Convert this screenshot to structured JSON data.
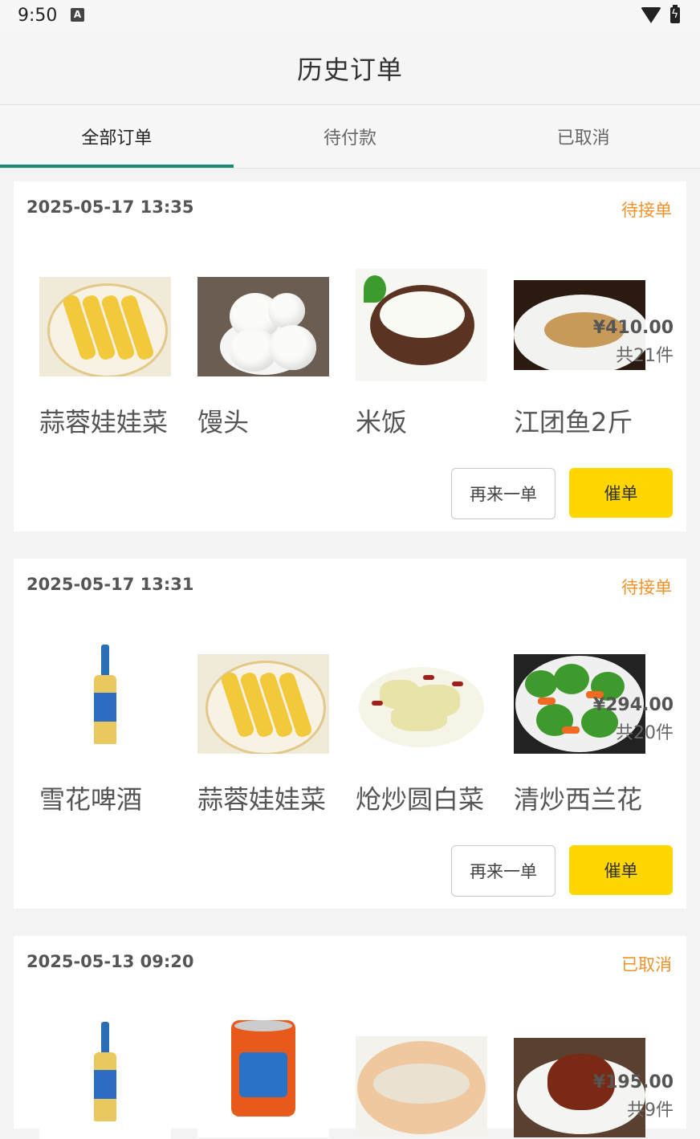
{
  "status_bar": {
    "time": "9:50",
    "notif_letter": "A"
  },
  "app_bar": {
    "title": "历史订单"
  },
  "tabs": [
    {
      "label": "全部订单",
      "active": true
    },
    {
      "label": "待付款",
      "active": false
    },
    {
      "label": "已取消",
      "active": false
    }
  ],
  "orders": [
    {
      "time": "2025-05-17 13:35",
      "status": "待接单",
      "items": [
        {
          "name": "蒜蓉娃娃菜",
          "image": "cabbage-dish-image"
        },
        {
          "name": "馒头",
          "image": "steamed-bun-image"
        },
        {
          "name": "米饭",
          "image": "rice-bowl-image"
        },
        {
          "name": "江团鱼2斤",
          "image": "steamed-fish-image"
        }
      ],
      "price": "¥410.00",
      "count": "共21件",
      "reorder_label": "再来一单",
      "urge_label": "催单"
    },
    {
      "time": "2025-05-17 13:31",
      "status": "待接单",
      "items": [
        {
          "name": "雪花啤酒",
          "image": "beer-bottle-image"
        },
        {
          "name": "蒜蓉娃娃菜",
          "image": "cabbage-dish-image"
        },
        {
          "name": "炝炒圆白菜",
          "image": "stir-fried-cabbage-image"
        },
        {
          "name": "清炒西兰花",
          "image": "broccoli-dish-image"
        }
      ],
      "price": "¥294.00",
      "count": "共20件",
      "reorder_label": "再来一单",
      "urge_label": "催单"
    },
    {
      "time": "2025-05-13 09:20",
      "status": "已取消",
      "items": [
        {
          "name": "",
          "image": "beer-bottle-image"
        },
        {
          "name": "",
          "image": "soda-can-image"
        },
        {
          "name": "",
          "image": "fish-dish-image"
        },
        {
          "name": "",
          "image": "braised-pork-image"
        }
      ],
      "price": "¥195.00",
      "count": "共9件"
    }
  ],
  "colors": {
    "tab_indicator": "#1a8a73",
    "status_text": "#f0922a",
    "urge_button": "#ffd600"
  }
}
